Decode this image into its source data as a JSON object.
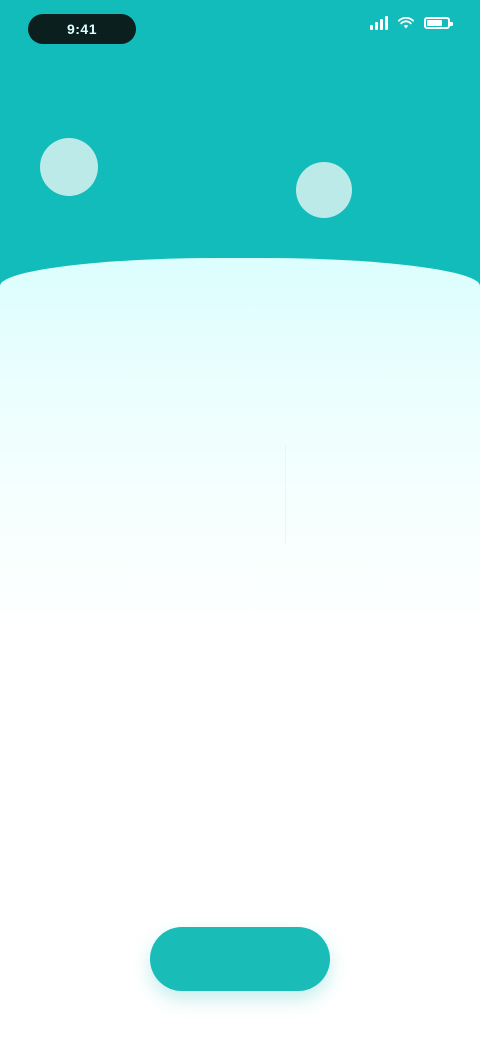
{
  "status_bar": {
    "time": "9:41",
    "icons": [
      "cellular-signal-icon",
      "wifi-icon",
      "battery-icon"
    ]
  },
  "header": {
    "background_color": "#12bcba",
    "decorations": [
      "circle",
      "circle"
    ]
  },
  "card": {
    "tagline": "",
    "title": "",
    "subtitle": "",
    "subtitle_2": ""
  },
  "stats": [
    {
      "value": "",
      "label": "",
      "sub": ""
    },
    {
      "value": "",
      "label": "",
      "sub": ""
    }
  ],
  "link": {
    "text": ""
  },
  "summary_row": {
    "left": "",
    "right": "",
    "sub": "",
    "sub_2": ""
  },
  "cta": {
    "label": "",
    "color": "#1abcb8"
  }
}
